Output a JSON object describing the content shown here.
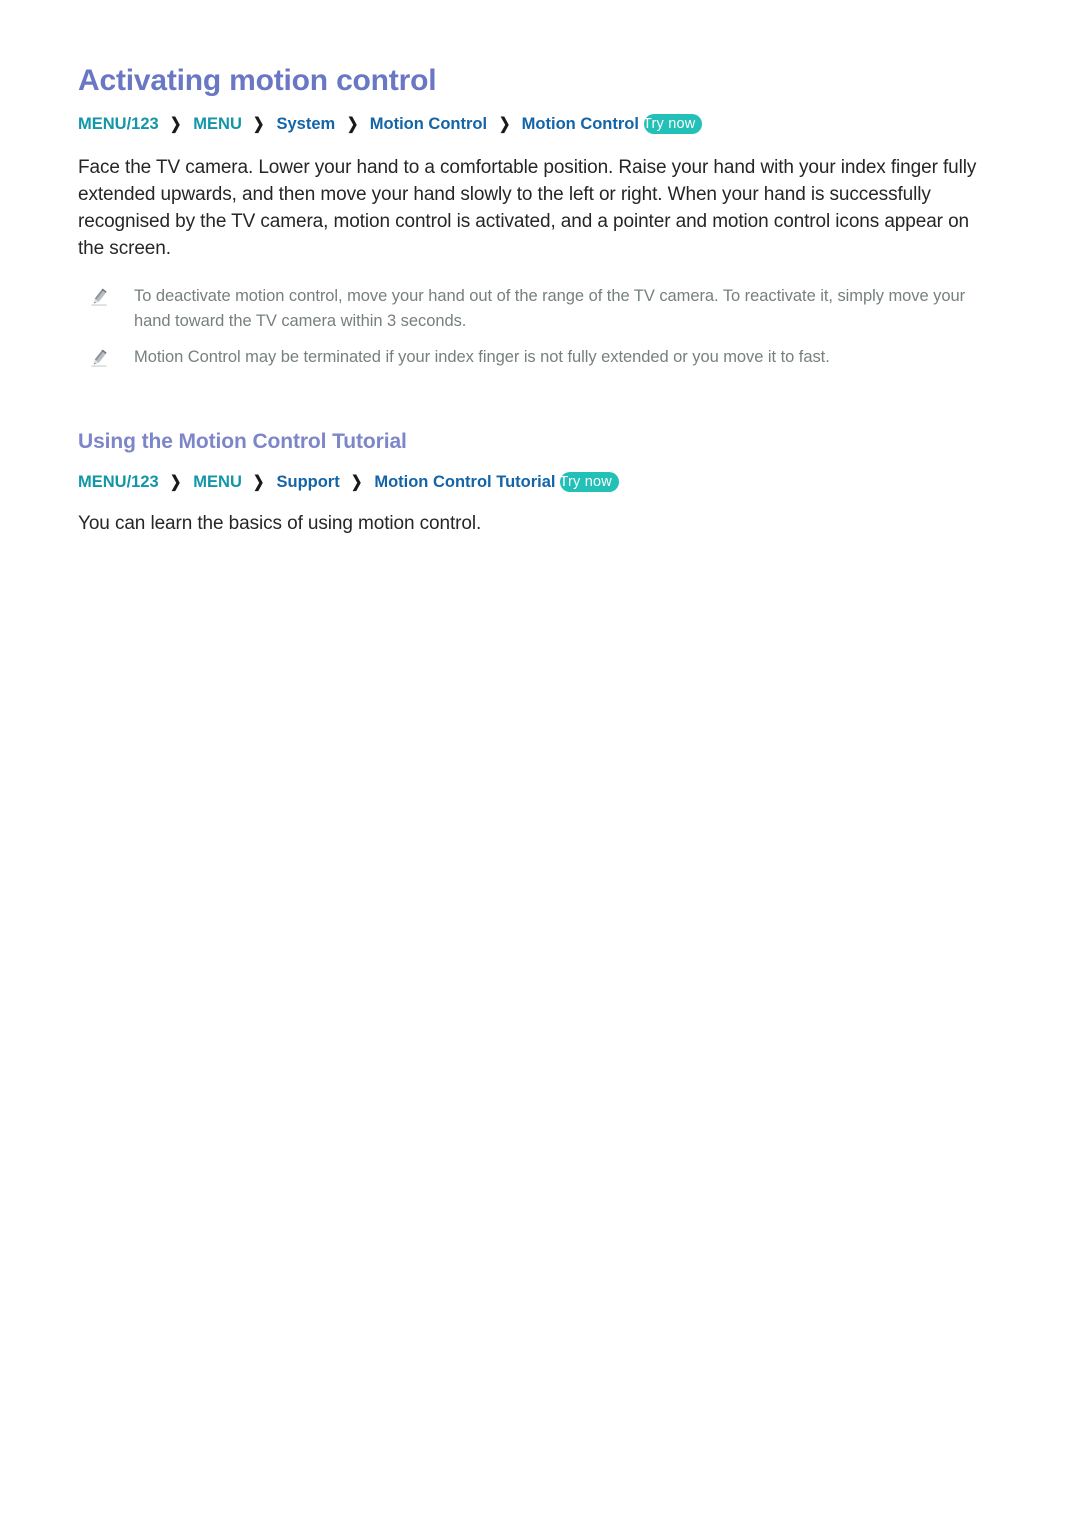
{
  "page": {
    "title": "Activating motion control"
  },
  "menu_path_1": {
    "crumbs": [
      {
        "label": "MENU/123",
        "tone": "teal"
      },
      {
        "label": "MENU",
        "tone": "teal"
      },
      {
        "label": "System",
        "tone": "blue"
      },
      {
        "label": "Motion Control",
        "tone": "blue"
      },
      {
        "label": "Motion Control",
        "tone": "blue"
      }
    ],
    "separator": "❯",
    "try_now_label": "Try now"
  },
  "intro": {
    "paragraph": "Face the TV camera. Lower your hand to a comfortable position. Raise your hand with your index finger fully extended upwards, and then move your hand slowly to the left or right. When your hand is successfully recognised by the TV camera, motion control is activated, and a pointer and motion control icons appear on the screen."
  },
  "notes": [
    {
      "icon": "pencil-icon",
      "text": "To deactivate motion control, move your hand out of the range of the TV camera. To reactivate it, simply move your hand toward the TV camera within 3 seconds."
    },
    {
      "icon": "pencil-icon",
      "text": "Motion Control may be terminated if your index finger is not fully extended or you move it to fast."
    }
  ],
  "section_tutorial": {
    "title": "Using the Motion Control Tutorial",
    "menu_path": {
      "crumbs": [
        {
          "label": "MENU/123",
          "tone": "teal"
        },
        {
          "label": "MENU",
          "tone": "teal"
        },
        {
          "label": "Support",
          "tone": "blue"
        },
        {
          "label": "Motion Control Tutorial",
          "tone": "blue"
        }
      ],
      "separator": "❯",
      "try_now_label": "Try now"
    },
    "paragraph": "You can learn the basics of using motion control."
  },
  "colors": {
    "title": "#6a77c4",
    "section_title": "#7d86c9",
    "crumb_teal": "#1296a8",
    "crumb_blue": "#1364a8",
    "try_now_bg": "#22c0b6",
    "body_text": "#262626",
    "note_text": "#76807f",
    "page_bg": "#ffffff"
  }
}
